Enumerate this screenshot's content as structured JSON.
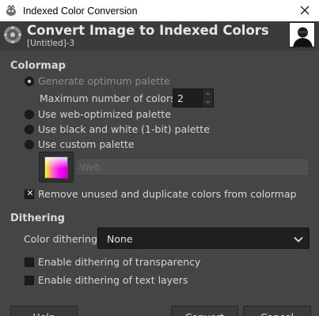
{
  "window": {
    "title": "Indexed Color Conversion"
  },
  "header": {
    "title": "Convert Image to Indexed Colors",
    "subtitle": "[Untitled]-3"
  },
  "colormap": {
    "section_title": "Colormap",
    "generate_optimum": "Generate optimum palette",
    "max_colors_label": "Maximum number of colors:",
    "max_colors_value": "2",
    "web_optimized": "Use web-optimized palette",
    "black_white": "Use black and white (1-bit) palette",
    "custom_palette": "Use custom palette",
    "custom_palette_name": "Web",
    "remove_unused": "Remove unused and duplicate colors from colormap"
  },
  "dithering": {
    "section_title": "Dithering",
    "color_dithering_label": "Color dithering:",
    "color_dithering_value": "None",
    "transparency": "Enable dithering of transparency",
    "text_layers": "Enable dithering of text layers"
  },
  "buttons": {
    "help": "Help",
    "convert": "Convert",
    "cancel": "Cancel"
  }
}
